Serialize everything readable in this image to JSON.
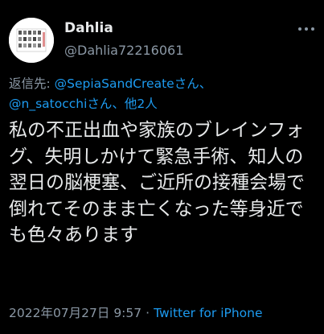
{
  "colors": {
    "background": "#000000",
    "text": "#e7e9ea",
    "muted": "#8b98a5",
    "link": "#1d9bf0"
  },
  "user": {
    "display_name": "Dahlia",
    "handle": "@Dahlia72216061",
    "avatar_icon": "avatar-image"
  },
  "more_icon": "more-dots-icon",
  "reply": {
    "prefix": "返信先: ",
    "mention1": "@SepiaSandCreate",
    "mention1_suffix": "さん、",
    "mention2": "@n_satocchi",
    "mention2_suffix": "さん、",
    "others": "他2人"
  },
  "tweet": {
    "text": "私の不正出血や家族のブレインフォグ、失明しかけて緊急手術、知人の翌日の脳梗塞、ご近所の接種会場で倒れてそのまま亡くなった等身近でも色々あります"
  },
  "meta": {
    "timestamp": "2022年07月27日 9:57",
    "separator": "·",
    "source": "Twitter for iPhone"
  }
}
